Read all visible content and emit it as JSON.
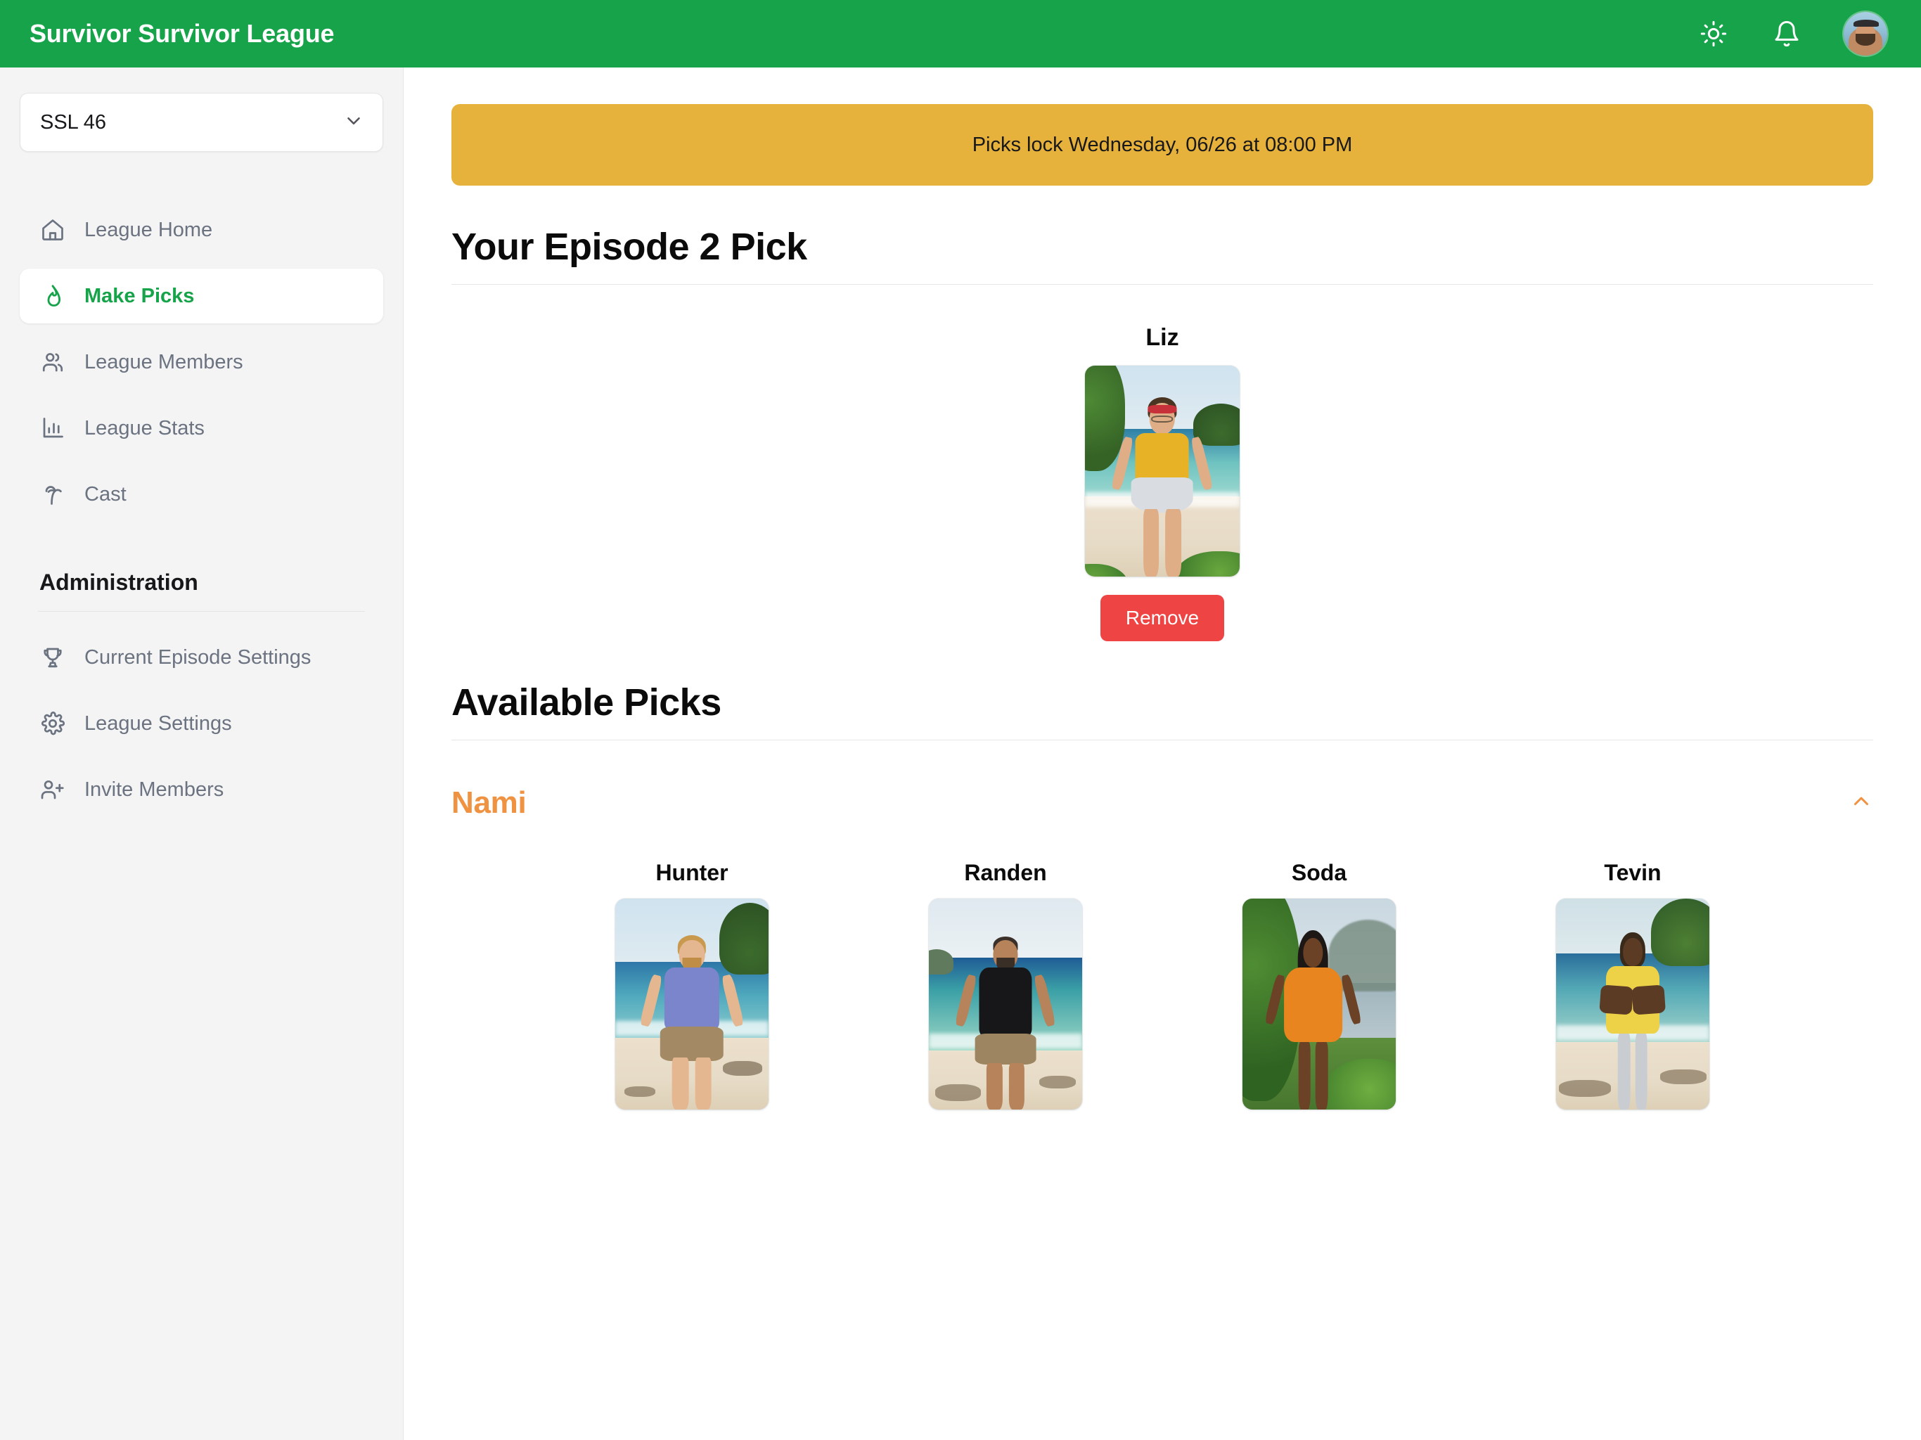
{
  "header": {
    "brand": "Survivor Survivor League",
    "theme_toggle_icon": "sun-icon",
    "notifications_icon": "bell-icon",
    "avatar_icon": "user-avatar"
  },
  "sidebar": {
    "league_selector": {
      "value": "SSL 46",
      "chevron_icon": "chevron-down-icon"
    },
    "nav_items": [
      {
        "label": "League Home",
        "icon": "home-icon",
        "active": false
      },
      {
        "label": "Make Picks",
        "icon": "flame-icon",
        "active": true
      },
      {
        "label": "League Members",
        "icon": "users-icon",
        "active": false
      },
      {
        "label": "League Stats",
        "icon": "bar-chart-icon",
        "active": false
      },
      {
        "label": "Cast",
        "icon": "palm-tree-icon",
        "active": false
      }
    ],
    "admin_heading": "Administration",
    "admin_items": [
      {
        "label": "Current Episode Settings",
        "icon": "trophy-icon"
      },
      {
        "label": "League Settings",
        "icon": "gear-icon"
      },
      {
        "label": "Invite Members",
        "icon": "user-plus-icon"
      }
    ]
  },
  "main": {
    "lock_banner": "Picks lock Wednesday, 06/26 at 08:00 PM",
    "your_pick_title": "Your Episode 2 Pick",
    "current_pick": {
      "name": "Liz",
      "remove_label": "Remove"
    },
    "available_title": "Available Picks",
    "tribe": {
      "name": "Nami",
      "collapse_icon": "chevron-up-icon",
      "color": "#ef9241",
      "members": [
        {
          "name": "Hunter"
        },
        {
          "name": "Randen"
        },
        {
          "name": "Soda"
        },
        {
          "name": "Tevin"
        }
      ]
    }
  },
  "colors": {
    "brand_green": "#16a34a",
    "banner_amber": "#e6b23c",
    "danger_red": "#ef4444",
    "tribe_orange": "#ef9241",
    "sidebar_bg": "#f4f4f5"
  }
}
